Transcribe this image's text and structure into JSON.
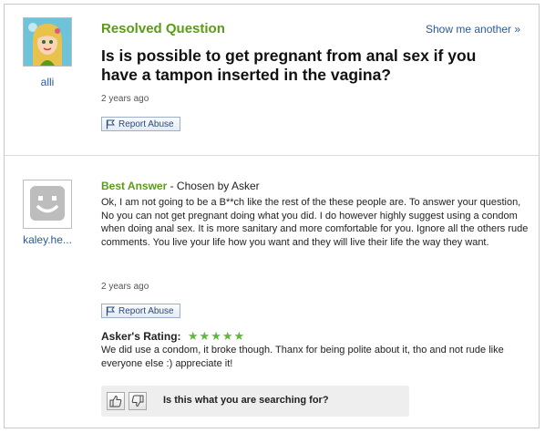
{
  "question": {
    "asker": "alli",
    "status": "Resolved Question",
    "show_more": "Show me another »",
    "title": "Is is possible to get pregnant from anal sex if you have a tampon inserted in the vagina?",
    "time_ago": "2 years ago",
    "report_label": "Report Abuse"
  },
  "answer": {
    "answerer": "kaley.he...",
    "best_label": "Best Answer",
    "chosen_by": " - Chosen by Asker",
    "text": "Ok, I am not going to be a B**ch like the rest of the these people are. To answer your question, No you can not get pregnant doing what you did. I do however highly suggest using a condom when doing anal sex. It is more sanitary and more comfortable for you. Ignore all the others rude comments. You live your life how you want and they will live their life the way they want.",
    "time_ago": "2 years ago",
    "report_label": "Report Abuse",
    "rating_label": "Asker's Rating:",
    "rating_stars": "★★★★★",
    "rating_value": 5,
    "rating_comment": "We did use a condom, it broke though. Thanx for being polite about it, tho and not rude like everyone else :) appreciate it!"
  },
  "feedback": {
    "question": "Is this what you are searching for?"
  },
  "colors": {
    "resolved_green": "#5a9c16",
    "link_blue": "#2a5a9a",
    "star_green": "#5fb83a"
  }
}
